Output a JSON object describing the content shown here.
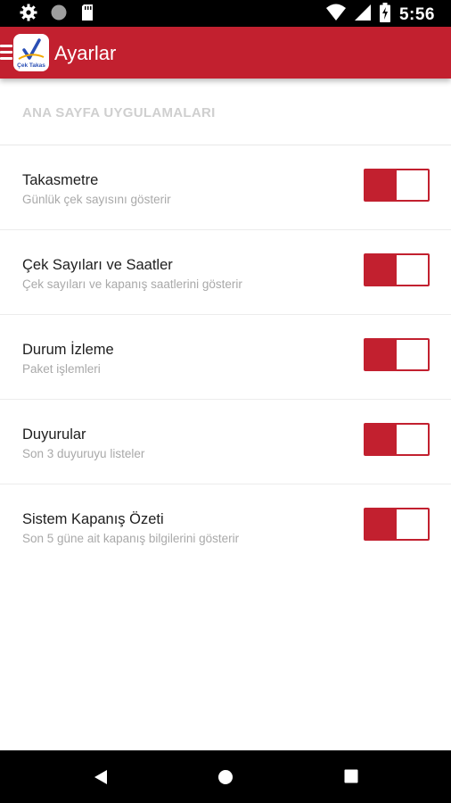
{
  "status_bar": {
    "time": "5:56",
    "icons": [
      "settings-icon",
      "circle-icon",
      "sd-card-icon",
      "wifi-icon",
      "signal-icon",
      "battery-icon"
    ]
  },
  "app_bar": {
    "title": "Ayarlar",
    "logo_text": "Çek Takas",
    "color": "#c2202f"
  },
  "section": {
    "header": "ANA SAYFA UYGULAMALARI"
  },
  "settings": [
    {
      "title": "Takasmetre",
      "subtitle": "Günlük çek sayısını gösterir",
      "enabled": true
    },
    {
      "title": "Çek Sayıları ve Saatler",
      "subtitle": "Çek sayıları ve kapanış saatlerini gösterir",
      "enabled": true
    },
    {
      "title": "Durum İzleme",
      "subtitle": "Paket işlemleri",
      "enabled": true
    },
    {
      "title": "Duyurular",
      "subtitle": "Son 3 duyuruyu listeler",
      "enabled": true
    },
    {
      "title": "Sistem Kapanış Özeti",
      "subtitle": "Son 5 güne ait kapanış bilgilerini gösterir",
      "enabled": true
    }
  ],
  "nav_bar": {
    "buttons": [
      "back-icon",
      "home-icon",
      "recents-icon"
    ]
  }
}
